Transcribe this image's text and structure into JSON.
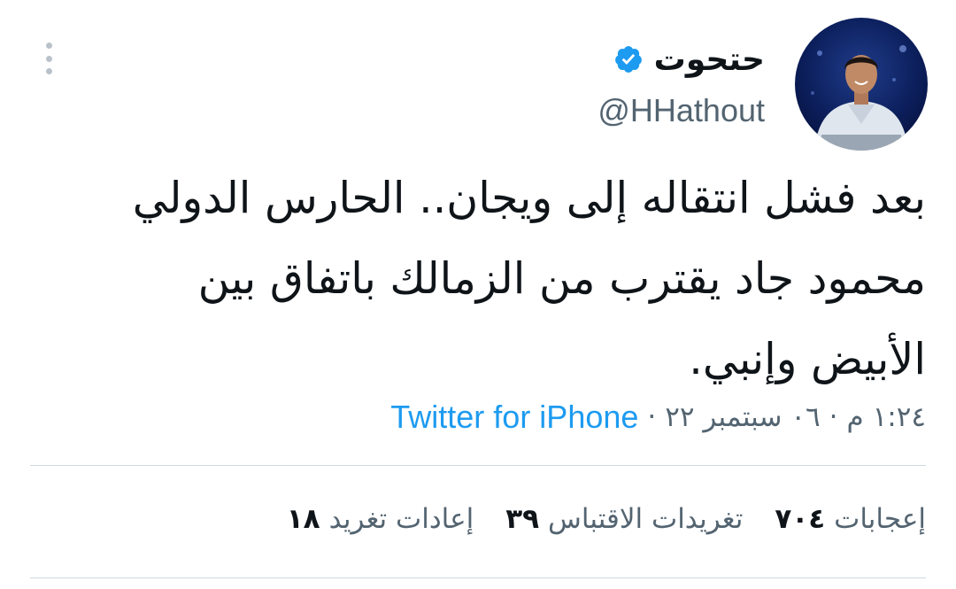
{
  "author": {
    "display_name": "حتحوت",
    "handle": "@HHathout",
    "verified": true,
    "avatar_icon": "profile-photo"
  },
  "tweet": {
    "lines": [
      "بعد فشل انتقاله إلى ويجان.. الحارس الدولي",
      "محمود جاد يقترب من الزمالك باتفاق بين",
      "الأبيض وإنبي."
    ]
  },
  "meta": {
    "time": "١:٢٤ م",
    "separator": "·",
    "date": "٠٦ سبتمبر ٢٢",
    "source": "Twitter for iPhone"
  },
  "stats": {
    "retweets": {
      "count": "١٨",
      "label": "إعادات تغريد"
    },
    "quotes": {
      "count": "٣٩",
      "label": "تغريدات الاقتباس"
    },
    "likes": {
      "count": "٧٠٤",
      "label": "إعجابات"
    }
  },
  "colors": {
    "verified_badge": "#1d9bf0",
    "link": "#1d9bf0",
    "secondary_text": "#536471",
    "divider": "#cfd9de"
  }
}
